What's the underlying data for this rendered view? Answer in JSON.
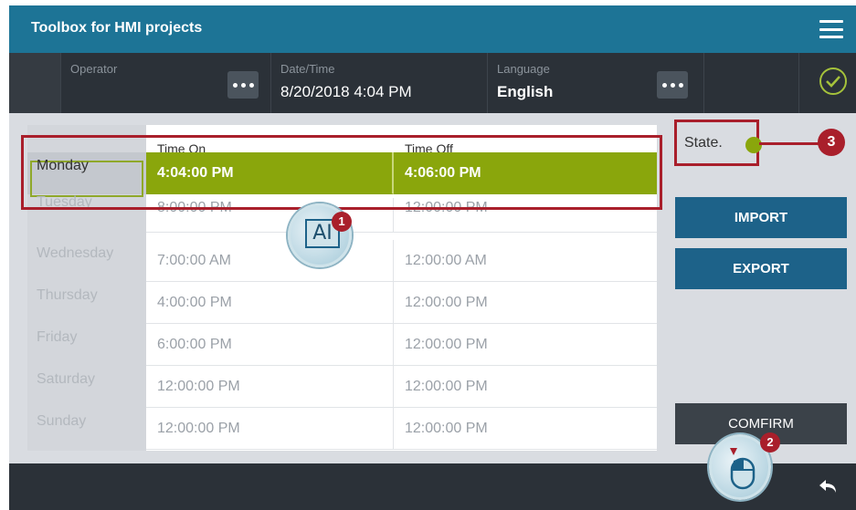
{
  "app": {
    "title": "Toolbox for HMI projects"
  },
  "header": {
    "operator_label": "Operator",
    "datetime_label": "Date/Time",
    "datetime_value": "8/20/2018 4:04 PM",
    "language_label": "Language",
    "language_value": "English"
  },
  "table": {
    "col1_header": "Time On",
    "col2_header": "Time Off",
    "rows": [
      {
        "day": "Monday",
        "on": "4:04:00 PM",
        "off": "4:06:00 PM",
        "selected": true
      },
      {
        "day": "Tuesday",
        "on": "8:00:00 PM",
        "off": "12:00:00 PM"
      },
      {
        "day": "Wednesday",
        "on": "7:00:00 AM",
        "off": "12:00:00 AM"
      },
      {
        "day": "Thursday",
        "on": "4:00:00 PM",
        "off": "12:00:00 PM"
      },
      {
        "day": "Friday",
        "on": "6:00:00 PM",
        "off": "12:00:00 PM"
      },
      {
        "day": "Saturday",
        "on": "12:00:00 PM",
        "off": "12:00:00 PM"
      },
      {
        "day": "Sunday",
        "on": "12:00:00 PM",
        "off": "12:00:00 PM"
      }
    ]
  },
  "side": {
    "state_label": "State.",
    "import_label": "IMPORT",
    "export_label": "EXPORT",
    "confirm_label": "COMFIRM"
  },
  "annotations": {
    "badge1": "1",
    "badge2": "2",
    "badge3": "3",
    "text_cursor": "AI"
  },
  "colors": {
    "title_bar": "#1d7496",
    "header_bar": "#2b3138",
    "selected_row": "#8aa60c",
    "state_ok": "#8aa60c",
    "button_blue": "#1d6289",
    "annotation_red": "#a91f2b"
  },
  "icons": [
    "hamburger-menu-icon",
    "more-dots-icon",
    "check-circle-icon",
    "back-arrow-icon",
    "text-cursor-icon",
    "mouse-icon"
  ]
}
